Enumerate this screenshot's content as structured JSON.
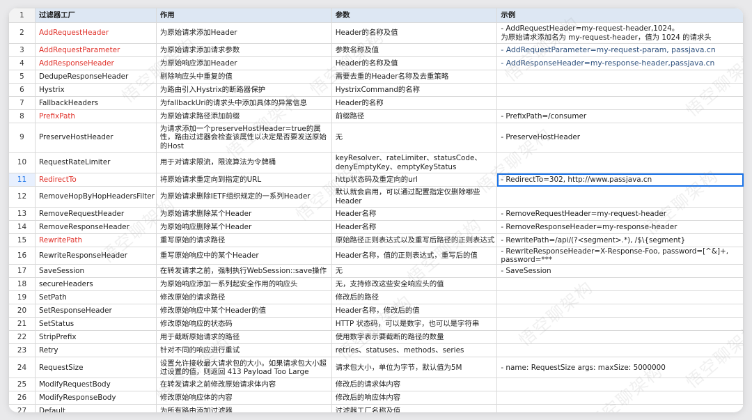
{
  "watermark": "悟空聊架构",
  "header": {
    "row_number": "1",
    "col_filter": "过滤器工厂",
    "col_purpose": "作用",
    "col_params": "参数",
    "col_example": "示例"
  },
  "rows": [
    {
      "n": "2",
      "name": "AddRequestHeader",
      "desc": "为原始请求添加Header",
      "param": "Header的名称及值",
      "example": "- AddRequestHeader=my-request-header,1024。\n为原始请求添加名为 my-request-header，值为 1024 的请求头"
    },
    {
      "n": "3",
      "name": "AddRequestParameter",
      "desc": "为原始请求添加请求参数",
      "param": "参数名称及值",
      "example": "- AddRequestParameter=my-request-param, passjava.cn"
    },
    {
      "n": "4",
      "name": "AddResponseHeader",
      "desc": "为原始响应添加Header",
      "param": "Header的名称及值",
      "example": "- AddResponseHeader=my-response-header,passjava.cn"
    },
    {
      "n": "5",
      "name": "DedupeResponseHeader",
      "desc": "剔除响应头中重复的值",
      "param": "需要去重的Header名称及去重策略",
      "example": ""
    },
    {
      "n": "6",
      "name": "Hystrix",
      "desc": "为路由引入Hystrix的断路器保护",
      "param": "HystrixCommand的名称",
      "example": ""
    },
    {
      "n": "7",
      "name": "FallbackHeaders",
      "desc": "为fallbackUri的请求头中添加具体的异常信息",
      "param": "Header的名称",
      "example": ""
    },
    {
      "n": "8",
      "name": "PrefixPath",
      "desc": "为原始请求路径添加前缀",
      "param": "前缀路径",
      "example": "- PrefixPath=/consumer"
    },
    {
      "n": "9",
      "name": "PreserveHostHeader",
      "desc": "为请求添加一个preserveHostHeader=true的属性，路由过滤器会检查该属性以决定是否要发送原始的Host",
      "param": "无",
      "example": "- PreserveHostHeader"
    },
    {
      "n": "10",
      "name": "RequestRateLimiter",
      "desc": "用于对请求限流，限流算法为令牌桶",
      "param": "keyResolver、rateLimiter、statusCode、denyEmptyKey、emptyKeyStatus",
      "example": ""
    },
    {
      "n": "11",
      "name": "RedirectTo",
      "desc": "将原始请求重定向到指定的URL",
      "param": "http状态码及重定向的url",
      "example": "- RedirectTo=302, http://www.passjava.cn"
    },
    {
      "n": "12",
      "name": "RemoveHopByHopHeadersFilter",
      "desc": "为原始请求删除IETF组织规定的一系列Header",
      "param": "默认就会启用，可以通过配置指定仅删除哪些Header",
      "example": ""
    },
    {
      "n": "13",
      "name": "RemoveRequestHeader",
      "desc": "为原始请求删除某个Header",
      "param": "Header名称",
      "example": "- RemoveRequestHeader=my-request-header"
    },
    {
      "n": "14",
      "name": "RemoveResponseHeader",
      "desc": "为原始响应删除某个Header",
      "param": "Header名称",
      "example": "- RemoveResponseHeader=my-response-header"
    },
    {
      "n": "15",
      "name": "RewritePath",
      "desc": "重写原始的请求路径",
      "param": "原始路径正则表达式以及重写后路径的正则表达式",
      "example": "- RewritePath=/api/(?<segment>.*), /$\\{segment}"
    },
    {
      "n": "16",
      "name": "RewriteResponseHeader",
      "desc": "重写原始响应中的某个Header",
      "param": "Header名称，值的正则表达式，重写后的值",
      "example": "- RewriteResponseHeader=X-Response-Foo, password=[^&]+, password=***"
    },
    {
      "n": "17",
      "name": "SaveSession",
      "desc": "在转发请求之前，强制执行WebSession::save操作",
      "param": "无",
      "example": "- SaveSession"
    },
    {
      "n": "18",
      "name": "secureHeaders",
      "desc": "为原始响应添加一系列起安全作用的响应头",
      "param": "无，支持修改这些安全响应头的值",
      "example": ""
    },
    {
      "n": "19",
      "name": "SetPath",
      "desc": "修改原始的请求路径",
      "param": "修改后的路径",
      "example": ""
    },
    {
      "n": "20",
      "name": "SetResponseHeader",
      "desc": "修改原始响应中某个Header的值",
      "param": "Header名称，修改后的值",
      "example": ""
    },
    {
      "n": "21",
      "name": "SetStatus",
      "desc": "修改原始响应的状态码",
      "param": "HTTP 状态码，可以是数字，也可以是字符串",
      "example": ""
    },
    {
      "n": "22",
      "name": "StripPrefix",
      "desc": "用于截断原始请求的路径",
      "param": "使用数字表示要截断的路径的数量",
      "example": ""
    },
    {
      "n": "23",
      "name": "Retry",
      "desc": "针对不同的响应进行重试",
      "param": "retries、statuses、methods、series",
      "example": ""
    },
    {
      "n": "24",
      "name": "RequestSize",
      "desc": "设置允许接收最大请求包的大小。如果请求包大小超过设置的值，则返回 413 Payload Too Large",
      "param": "请求包大小，单位为字节，默认值为5M",
      "example": "- name: RequestSize args: maxSize: 5000000"
    },
    {
      "n": "25",
      "name": "ModifyRequestBody",
      "desc": "在转发请求之前修改原始请求体内容",
      "param": "修改后的请求体内容",
      "example": ""
    },
    {
      "n": "26",
      "name": "ModifyResponseBody",
      "desc": "修改原始响应体的内容",
      "param": "修改后的响应体内容",
      "example": ""
    },
    {
      "n": "27",
      "name": "Default",
      "desc": "为所有路由添加过滤器",
      "param": "过滤器工厂名称及值",
      "example": ""
    }
  ],
  "highlight_color": "#e0312a",
  "selection_color": "#1a73e8"
}
